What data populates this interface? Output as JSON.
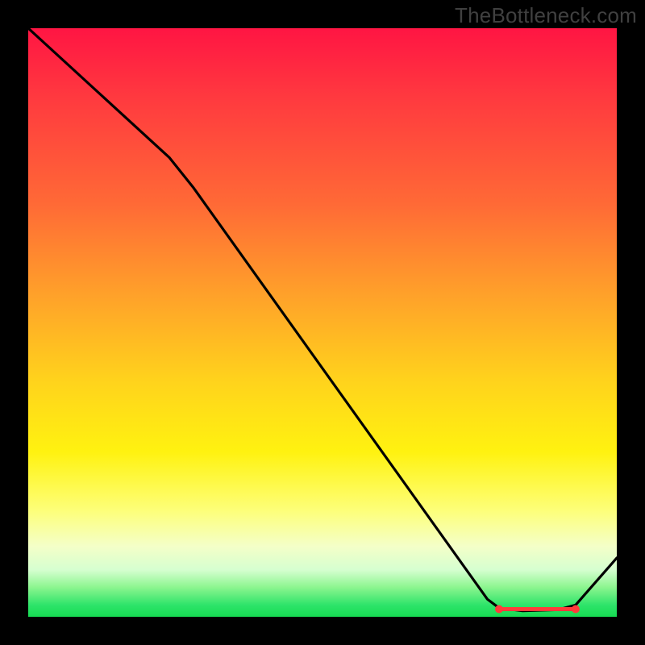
{
  "watermark": "TheBottleneck.com",
  "chart_data": {
    "type": "line",
    "title": "",
    "xlabel": "",
    "ylabel": "",
    "ylim": [
      0,
      100
    ],
    "xlim": [
      0,
      100
    ],
    "series": [
      {
        "name": "curve",
        "points": [
          {
            "x": 0,
            "y": 100
          },
          {
            "x": 24,
            "y": 78
          },
          {
            "x": 28,
            "y": 73
          },
          {
            "x": 78,
            "y": 3
          },
          {
            "x": 80,
            "y": 1.5
          },
          {
            "x": 84,
            "y": 1
          },
          {
            "x": 90,
            "y": 1.2
          },
          {
            "x": 93,
            "y": 2
          },
          {
            "x": 100,
            "y": 10
          }
        ]
      }
    ],
    "flat_marker": {
      "x_start": 80,
      "x_end": 93,
      "y": 1.3,
      "color": "#ff3b3b"
    },
    "colors": {
      "curve": "#000000",
      "marker": "#ff3b3b",
      "gradient_top": "#ff1543",
      "gradient_bottom": "#16db52",
      "background": "#000000",
      "watermark": "#404040"
    }
  }
}
